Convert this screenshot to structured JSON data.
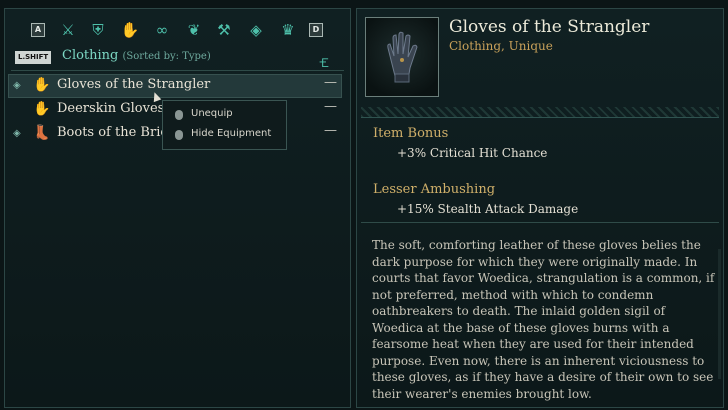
{
  "inventory": {
    "categories": {
      "left_key": "A",
      "right_key": "D",
      "icons": [
        "weapons-icon",
        "armor-icon",
        "outfit-icon",
        "clothing-icon",
        "rings-icon",
        "trinkets-icon",
        "smithing-icon",
        "gems-icon",
        "crown-icon"
      ]
    },
    "sort_key": "L.SHIFT",
    "category_label": "Clothing",
    "sort_label": "(Sorted by: Type)",
    "items": [
      {
        "name": "Gloves of the Strangler",
        "equipped": true,
        "selected": true,
        "value": "—"
      },
      {
        "name": "Deerskin Gloves",
        "equipped": false,
        "selected": false,
        "value": "—"
      },
      {
        "name": "Boots of the Brickla",
        "equipped": true,
        "selected": false,
        "value": "—"
      }
    ],
    "context_menu": [
      "Unequip",
      "Hide Equipment"
    ]
  },
  "detail": {
    "title": "Gloves of the Strangler",
    "subtitle": "Clothing, Unique",
    "bonuses": [
      {
        "heading": "Item Bonus",
        "value": "+3% Critical Hit Chance"
      },
      {
        "heading": "Lesser Ambushing",
        "value": "+15% Stealth Attack Damage"
      }
    ],
    "description": "The soft, comforting leather of these gloves belies the dark purpose for which they were originally made. In courts that favor Woedica, strangulation is a common, if not preferred, method with which to condemn oathbreakers to death. The inlaid golden sigil of Woedica at the base of these gloves burns with a fearsome heat when they are used for their intended purpose. Even now, there is an inherent viciousness to these gloves, as if they have a desire of their own to see their wearer's enemies brought low."
  },
  "colors": {
    "accent": "#4ec1ab",
    "gold": "#c9a15a",
    "panel_border": "#2c4645",
    "background": "#0b1516"
  }
}
